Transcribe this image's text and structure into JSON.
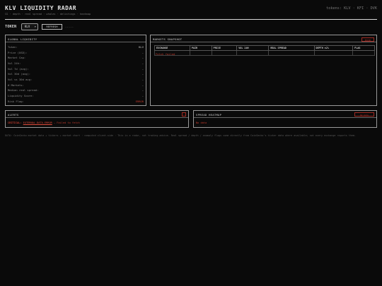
{
  "header": {
    "title": "KLV LIQUIDITY RADAR",
    "subtitle": "CG · depth · real spread · whales · delistings · heatmap",
    "tokens_readout": "tokens: KLV · KFI · DVK"
  },
  "controls": {
    "token_label": "TOKEN",
    "token_selected": "KLV",
    "refresh_label": "REFRESH",
    "status_text": "-----"
  },
  "global_panel": {
    "title": "GLOBAL LIQUIDITY",
    "rows": [
      {
        "key": "Token:",
        "value": "KLV"
      },
      {
        "key": "Price (USD):",
        "value": "-"
      },
      {
        "key": "Market Cap:",
        "value": "-"
      },
      {
        "key": "Vol 24h:",
        "value": "-"
      },
      {
        "key": "Vol 7d (avg):",
        "value": "-"
      },
      {
        "key": "Vol 30d (avg):",
        "value": "-"
      },
      {
        "key": "Vol vs 30d avg:",
        "value": "-"
      },
      {
        "key": "# Markets:",
        "value": "-"
      },
      {
        "key": "Median real spread:",
        "value": "-"
      },
      {
        "key": "Liquidity Score:",
        "value": "-"
      },
      {
        "key": "Risk Flag:",
        "value": "ERROR",
        "error": true
      }
    ]
  },
  "markets_panel": {
    "title": "MARKETS SNAPSHOT",
    "badge": "ERROR",
    "columns": [
      "EXCHANGE",
      "PAIR",
      "PRICE",
      "VOL 24H",
      "REAL SPREAD",
      "DEPTH ±2%",
      "FLAG"
    ],
    "error_text": "Fetch failed"
  },
  "alerts_panel": {
    "title": "ALERTS",
    "badge": "!",
    "alert_level": "CRITICAL:",
    "alert_code": "EXTERNAL-DATA-ERROR",
    "alert_text": "— Failed to fetch"
  },
  "heatmap_panel": {
    "title": "SPREAD HEATMAP",
    "badge": "NO DATA",
    "empty_text": "No data"
  },
  "footer": {
    "text": "DATA: CoinGecko market data + tickers + market chart · computed client-side · This is a radar, not trading advice. Real spread / depth / anomaly flags come directly from CoinGecko's ticker data where available; not every exchange reports them."
  },
  "colors": {
    "background": "#0a0a0a",
    "error_red": "#c0392b",
    "border_gray": "#9a9a9a"
  }
}
